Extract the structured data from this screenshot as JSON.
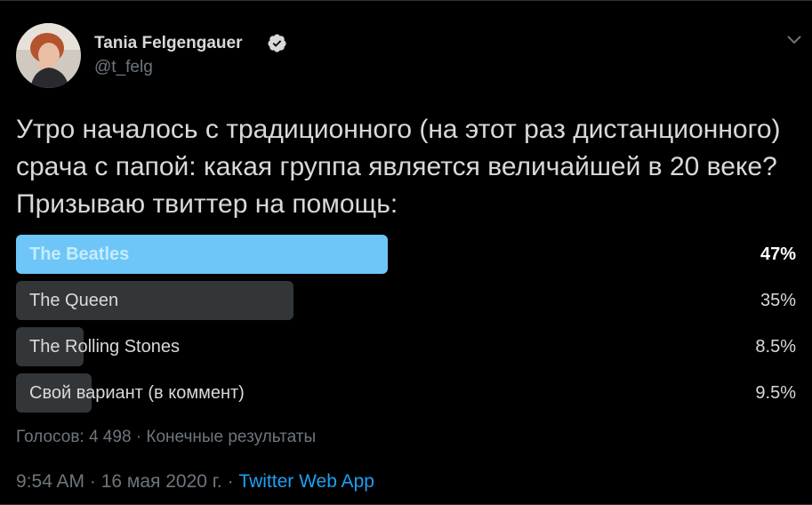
{
  "author": {
    "name": "Tania Felgengauer",
    "handle": "@t_felg",
    "verified": true,
    "avatar_icon": "user-avatar-photo"
  },
  "tweet": {
    "text": "Утро началось с традиционного (на этот раз дистанционного) срача с папой: какая группа является величайшей в 20 веке? Призываю твиттер на помощь:"
  },
  "poll": {
    "options": [
      {
        "label": "The Beatles",
        "percent_text": "47%",
        "percent": 47,
        "winner": true
      },
      {
        "label": "The Queen",
        "percent_text": "35%",
        "percent": 35,
        "winner": false
      },
      {
        "label": "The Rolling Stones",
        "percent_text": "8.5%",
        "percent": 8.5,
        "winner": false
      },
      {
        "label": "Свой вариант (в коммент)",
        "percent_text": "9.5%",
        "percent": 9.5,
        "winner": false
      }
    ],
    "footer": "Голосов: 4 498 · Конечные результаты"
  },
  "meta": {
    "time": "9:54 AM",
    "separator": " · ",
    "date": "16 мая 2020 г.",
    "source": "Twitter Web App"
  },
  "colors": {
    "background": "#000000",
    "text": "#d9d9d9",
    "muted": "#6e767d",
    "accent": "#1da1f2",
    "winner_bar": "#6ec6f8",
    "bar": "#333639"
  }
}
